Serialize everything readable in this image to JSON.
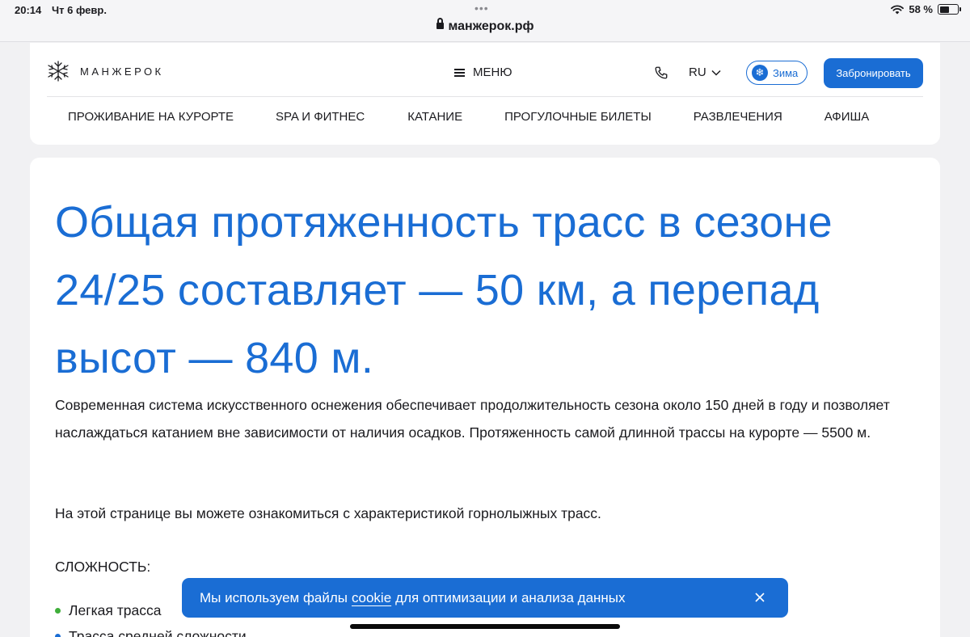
{
  "status_bar": {
    "time": "20:14",
    "date": "Чт 6 февр.",
    "url": "манжерок.рф",
    "battery": "58 %",
    "battery_level": 0.58
  },
  "header": {
    "logo_text": "МАНЖЕРОК",
    "menu_label": "МЕНЮ",
    "language": "RU",
    "season_label": "Зима",
    "book_label": "Забронировать",
    "nav": [
      "ПРОЖИВАНИЕ НА КУРОРТЕ",
      "SPA И ФИТНЕС",
      "КАТАНИЕ",
      "ПРОГУЛОЧНЫЕ БИЛЕТЫ",
      "РАЗВЛЕЧЕНИЯ",
      "АФИША"
    ]
  },
  "content": {
    "headline": "Общая протяженность трасс в сезоне 24/25 составляет — 50 км, а перепад высот — 840 м.",
    "paragraph": "Современная система искусственного оснежения обеспечивает продолжительность сезона около 150 дней в году и позволяет наслаждаться катанием вне зависимости от наличия осадков. Протяженность самой длинной трассы на курорте — 5500 м.",
    "intro": "На этой странице вы можете ознакомиться с характеристикой горнолыжных трасс.",
    "difficulty_title": "СЛОЖНОСТЬ:",
    "difficulty_levels": [
      {
        "label": "Легкая трасса",
        "color": "#3fae3a"
      },
      {
        "label": "Трасса средней сложности",
        "color": "#1a6dd4"
      }
    ]
  },
  "cookie": {
    "text_before": "Мы используем файлы",
    "link": "cookie",
    "text_after": "для оптимизации и анализа данных"
  },
  "colors": {
    "accent": "#1a6dd4",
    "easy": "#3fae3a"
  }
}
